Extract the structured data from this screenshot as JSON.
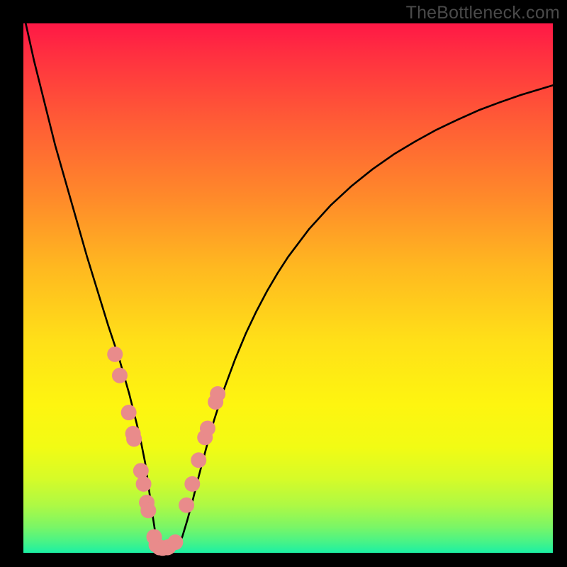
{
  "watermark": "TheBottleneck.com",
  "chart_data": {
    "type": "line",
    "title": "",
    "xlabel": "",
    "ylabel": "",
    "xlim": [
      0,
      100
    ],
    "ylim": [
      0,
      100
    ],
    "grid": false,
    "legend": false,
    "series": [
      {
        "name": "bottleneck-curve",
        "x": [
          0,
          2,
          4,
          6,
          8,
          10,
          12,
          14,
          16,
          18,
          19,
          20,
          21,
          22,
          23,
          23.5,
          24,
          24.5,
          25,
          25.5,
          26,
          26.5,
          27,
          28,
          29,
          30,
          31,
          32,
          33,
          34,
          35,
          36,
          38,
          40,
          42,
          44,
          46,
          48,
          50,
          54,
          58,
          62,
          66,
          70,
          74,
          78,
          82,
          86,
          90,
          94,
          98,
          100
        ],
        "y": [
          102,
          93,
          85,
          77,
          70,
          63,
          56,
          49.5,
          43,
          37,
          33.5,
          30,
          26,
          22,
          17,
          13.5,
          10,
          6.5,
          3.2,
          1.4,
          0.6,
          0.4,
          0.4,
          0.5,
          1.2,
          3,
          6.3,
          10,
          14,
          17.8,
          21.5,
          25,
          31.2,
          36.6,
          41.4,
          45.6,
          49.4,
          52.8,
          55.9,
          61.2,
          65.6,
          69.3,
          72.5,
          75.3,
          77.7,
          79.9,
          81.8,
          83.6,
          85.1,
          86.5,
          87.7,
          88.3
        ]
      }
    ],
    "markers": [
      {
        "name": "marker-group-left",
        "color": "#e98b8b",
        "x": [
          17.3,
          18.2,
          19.9,
          20.7,
          20.9,
          22.2,
          22.7,
          23.3,
          23.6,
          24.7,
          25.1,
          25.7,
          26.3,
          27.2,
          27.4
        ],
        "y": [
          37.5,
          33.5,
          26.5,
          22.5,
          21.5,
          15.5,
          13.0,
          9.5,
          8.0,
          3.0,
          1.5,
          1.0,
          0.9,
          1.0,
          1.1
        ]
      },
      {
        "name": "marker-group-right",
        "color": "#e98b8b",
        "x": [
          28.7,
          30.8,
          31.9,
          33.1,
          34.3,
          34.8,
          36.3,
          36.7
        ],
        "y": [
          2.0,
          9.0,
          13.0,
          17.5,
          21.8,
          23.5,
          28.5,
          30.0
        ]
      }
    ],
    "colors": {
      "curve": "#000000",
      "marker": "#e98b8b",
      "frame": "#000000",
      "watermark": "#4a4a4a"
    }
  }
}
